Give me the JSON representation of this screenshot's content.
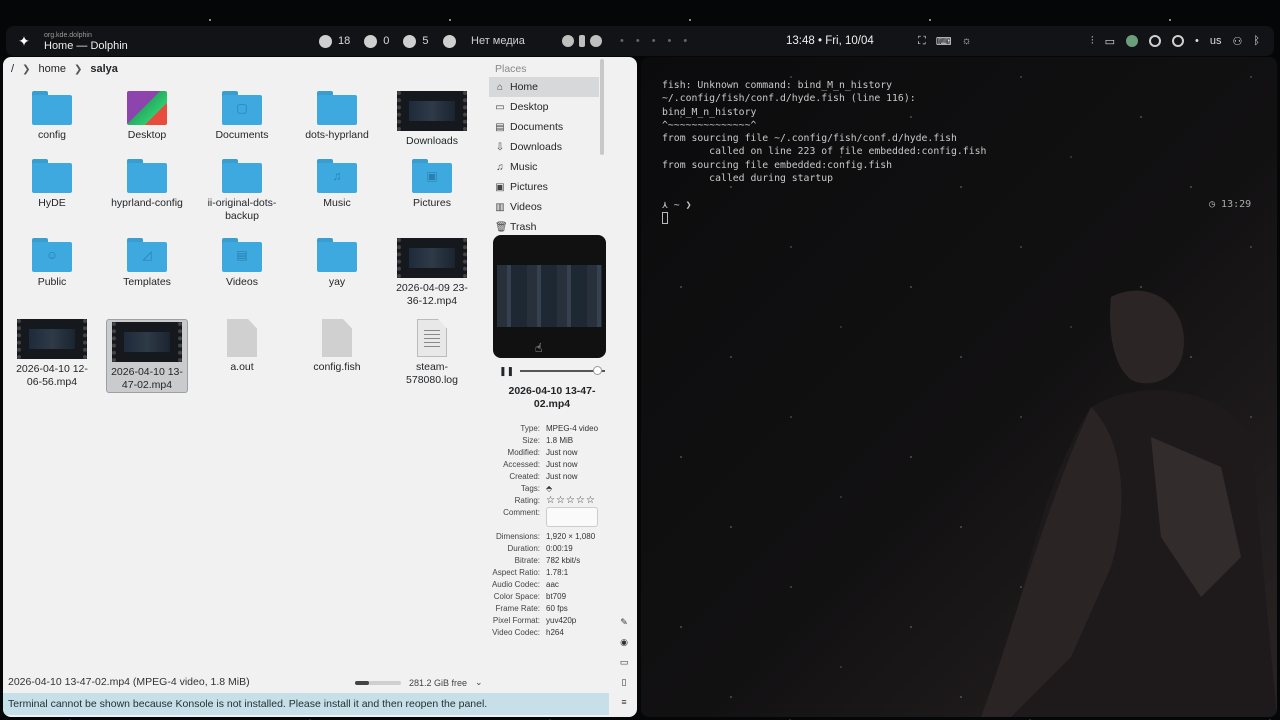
{
  "topbar": {
    "logo_icon": "sparkle-icon",
    "app_id": "org.kde.dolphin",
    "window_title": "Home — Dolphin",
    "stats": [
      {
        "icon": "cpu-icon",
        "value": "18"
      },
      {
        "icon": "gpu-icon",
        "value": "0"
      },
      {
        "icon": "memory-icon",
        "value": "5"
      }
    ],
    "media_text": "Нет медиа",
    "clock": "13:48 • Fri, 10/04",
    "keyboard_layout": "us"
  },
  "dolphin": {
    "breadcrumb": [
      "/",
      "home",
      "salya"
    ],
    "items": [
      {
        "label": "config",
        "type": "folder",
        "glyph": ""
      },
      {
        "label": "Desktop",
        "type": "desktop",
        "glyph": ""
      },
      {
        "label": "Documents",
        "type": "folder",
        "glyph": "▢"
      },
      {
        "label": "dots-hyprland",
        "type": "folder",
        "glyph": ""
      },
      {
        "label": "Downloads",
        "type": "video",
        "glyph": ""
      },
      {
        "label": "HyDE",
        "type": "folder",
        "glyph": ""
      },
      {
        "label": "hyprland-config",
        "type": "folder",
        "glyph": ""
      },
      {
        "label": "ii-original-dots-backup",
        "type": "folder",
        "glyph": ""
      },
      {
        "label": "Music",
        "type": "folder",
        "glyph": "♫"
      },
      {
        "label": "Pictures",
        "type": "folder",
        "glyph": "▣"
      },
      {
        "label": "Public",
        "type": "folder",
        "glyph": "☺"
      },
      {
        "label": "Templates",
        "type": "folder",
        "glyph": "◿"
      },
      {
        "label": "Videos",
        "type": "folder",
        "glyph": "▤"
      },
      {
        "label": "yay",
        "type": "folder",
        "glyph": ""
      },
      {
        "label": "2026-04-09 23-36-12.mp4",
        "type": "video",
        "glyph": ""
      },
      {
        "label": "2026-04-10 12-06-56.mp4",
        "type": "video",
        "glyph": ""
      },
      {
        "label": "2026-04-10 13-47-02.mp4",
        "type": "video",
        "glyph": "",
        "selected": true
      },
      {
        "label": "a.out",
        "type": "file",
        "glyph": ""
      },
      {
        "label": "config.fish",
        "type": "file",
        "glyph": ""
      },
      {
        "label": "steam-578080.log",
        "type": "log",
        "glyph": ""
      }
    ],
    "places": {
      "heading": "Places",
      "items": [
        {
          "label": "Home",
          "icon": "home-icon",
          "active": true
        },
        {
          "label": "Desktop",
          "icon": "desktop-icon"
        },
        {
          "label": "Documents",
          "icon": "documents-icon"
        },
        {
          "label": "Downloads",
          "icon": "downloads-icon"
        },
        {
          "label": "Music",
          "icon": "music-icon"
        },
        {
          "label": "Pictures",
          "icon": "pictures-icon"
        },
        {
          "label": "Videos",
          "icon": "videos-icon"
        },
        {
          "label": "Trash",
          "icon": "trash-icon"
        }
      ]
    },
    "info": {
      "filename": "2026-04-10 13-47-02.mp4",
      "play_progress": 0.97,
      "properties": [
        {
          "key": "Type:",
          "value": "MPEG-4 video"
        },
        {
          "key": "Size:",
          "value": "1.8 MiB"
        },
        {
          "key": "Modified:",
          "value": "Just now"
        },
        {
          "key": "Accessed:",
          "value": "Just now"
        },
        {
          "key": "Created:",
          "value": "Just now"
        },
        {
          "key": "Tags:",
          "value": ""
        },
        {
          "key": "Rating:",
          "value": "☆☆☆☆☆"
        },
        {
          "key": "Comment:",
          "value": ""
        },
        {
          "key": "Dimensions:",
          "value": "1,920 × 1,080"
        },
        {
          "key": "Duration:",
          "value": "0:00:19"
        },
        {
          "key": "Bitrate:",
          "value": "782 kbit/s"
        },
        {
          "key": "Aspect Ratio:",
          "value": "1.78:1"
        },
        {
          "key": "Audio Codec:",
          "value": "aac"
        },
        {
          "key": "Color Space:",
          "value": "bt709"
        },
        {
          "key": "Frame Rate:",
          "value": "60 fps"
        },
        {
          "key": "Pixel Format:",
          "value": "yuv420p"
        },
        {
          "key": "Video Codec:",
          "value": "h264"
        }
      ]
    },
    "status_text": "2026-04-10 13-47-02.mp4 (MPEG-4 video, 1.8 MiB)",
    "free_space": "281.2 GiB free",
    "free_used_fraction": 0.3,
    "konsole_message": "Terminal cannot be shown because Konsole is not installed. Please install it and then reopen the panel."
  },
  "terminal": {
    "lines": [
      "fish: Unknown command: bind_M_n_history",
      "~/.config/fish/conf.d/hyde.fish (line 116):",
      "bind_M_n_history",
      "^~~~~~~~~~~~~~~^",
      "from sourcing file ~/.config/fish/conf.d/hyde.fish",
      "        called on line 223 of file embedded:config.fish",
      "from sourcing file embedded:config.fish",
      "        called during startup",
      "",
      "⋏ ~ ❯"
    ],
    "right_prompt": "13:29"
  },
  "colors": {
    "accent_folder": "#3ea9de",
    "selection_bg": "#c9cbcd",
    "konsole_banner": "#c7dfe8"
  }
}
